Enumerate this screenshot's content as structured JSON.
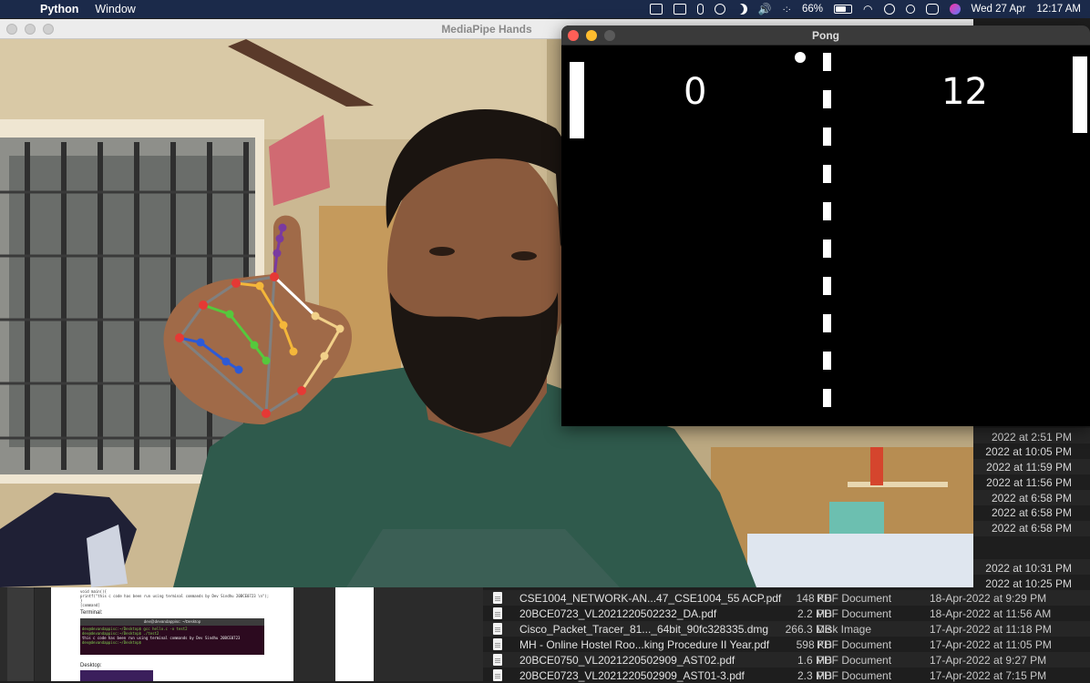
{
  "menubar": {
    "apple_icon": "apple-logo-icon",
    "app_name": "Python",
    "items": [
      "Window"
    ],
    "battery_percent": "66%",
    "battery_level": 0.66,
    "date": "Wed 27 Apr",
    "time": "12:17 AM"
  },
  "mediapipe_window": {
    "title": "MediaPipe Hands"
  },
  "pong_window": {
    "title": "Pong",
    "score_left": "0",
    "score_right": "12"
  },
  "finder_dates_column": [
    "2022 at 2:51 PM",
    "2022 at 10:05 PM",
    "2022 at 11:59 PM",
    "2022 at 11:56 PM",
    "2022 at 6:58 PM",
    "2022 at 6:58 PM",
    "2022 at 6:58 PM",
    "2022 at 10:31 PM",
    "2022 at 10:25 PM"
  ],
  "finder_files": [
    {
      "name": "CSE1004_NETWORK-AN...47_CSE1004_55 ACP.pdf",
      "size": "148 KB",
      "kind": "PDF Document",
      "date": "18-Apr-2022 at 9:29 PM"
    },
    {
      "name": "20BCE0723_VL2021220502232_DA.pdf",
      "size": "2.2 MB",
      "kind": "PDF Document",
      "date": "18-Apr-2022 at 11:56 AM"
    },
    {
      "name": "Cisco_Packet_Tracer_81..._64bit_90fc328335.dmg",
      "size": "266.3 MB",
      "kind": "Disk Image",
      "date": "17-Apr-2022 at 11:18 PM"
    },
    {
      "name": "MH - Online Hostel Roo...king Procedure II Year.pdf",
      "size": "598 KB",
      "kind": "PDF Document",
      "date": "17-Apr-2022 at 11:05 PM"
    },
    {
      "name": "20BCE0750_VL2021220502909_AST02.pdf",
      "size": "1.6 MB",
      "kind": "PDF Document",
      "date": "17-Apr-2022 at 9:27 PM"
    },
    {
      "name": "20BCE0723_VL2021220502909_AST01-3.pdf",
      "size": "2.3 MB",
      "kind": "PDF Document",
      "date": "17-Apr-2022 at 7:15 PM"
    }
  ],
  "doc_preview": {
    "code_lines": [
      "void main(){",
      "    printf(\"this c code has been run using terminal commands by Dev Sindhu 20BCE0723 \\n\");",
      "}",
      "[command]"
    ],
    "terminal_label": "Terminal:",
    "terminal_title": "dev@devandappisc: ~/Desktop",
    "terminal_lines": [
      "dev@devandappisc:~/Desktop$ gcc hello.c -o test2",
      "dev@devandappisc:~/Desktop$ ./test2",
      "this c code has been run using terminal commands by Dev Sindhu 20BCE0723",
      "dev@devandappisc:~/Desktop$ "
    ],
    "desktop_label": "Desktop:"
  }
}
